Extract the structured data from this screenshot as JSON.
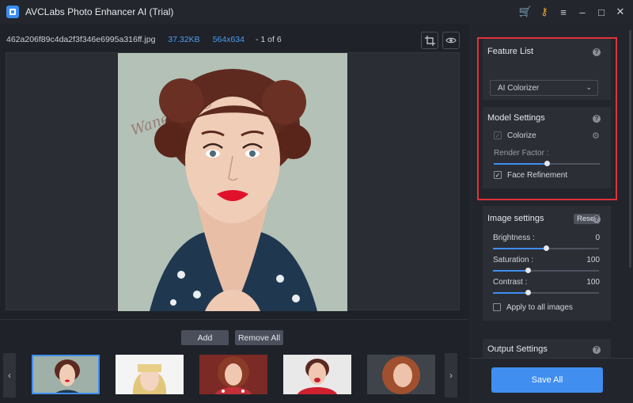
{
  "window": {
    "title": "AVCLabs Photo Enhancer AI (Trial)",
    "icons": [
      "cart-icon",
      "key-icon",
      "menu-icon",
      "minimize-icon",
      "maximize-icon",
      "close-icon"
    ]
  },
  "file": {
    "name": "462a206f89c4da2f3f346e6995a316ff.jpg",
    "size": "37.32KB",
    "dimensions": "564x634",
    "index": "- 1 of 6"
  },
  "watermark": "WaneneyPC",
  "thumbnails": {
    "add_label": "Add",
    "remove_all_label": "Remove All",
    "count": 5,
    "selected_index": 0
  },
  "feature_list": {
    "title": "Feature List",
    "selected": "AI Colorizer"
  },
  "model_settings": {
    "title": "Model Settings",
    "colorize_label": "Colorize",
    "colorize_checked": true,
    "render_factor_label": "Render Factor :",
    "render_factor_value": 0.5,
    "face_refinement_label": "Face Refinement",
    "face_refinement_checked": true
  },
  "image_settings": {
    "title": "Image settings",
    "reset_label": "Reset",
    "brightness": {
      "label": "Brightness :",
      "value": "0",
      "level": 0.5
    },
    "saturation": {
      "label": "Saturation :",
      "value": "100",
      "level": 0.33
    },
    "contrast": {
      "label": "Contrast :",
      "value": "100",
      "level": 0.33
    },
    "apply_all_label": "Apply to all images",
    "apply_all_checked": false
  },
  "output_settings": {
    "title": "Output Settings"
  },
  "save_all_label": "Save All",
  "colors": {
    "accent": "#3f8ef0",
    "highlight_frame": "#e0323a",
    "file_meta": "#4b9df2"
  }
}
